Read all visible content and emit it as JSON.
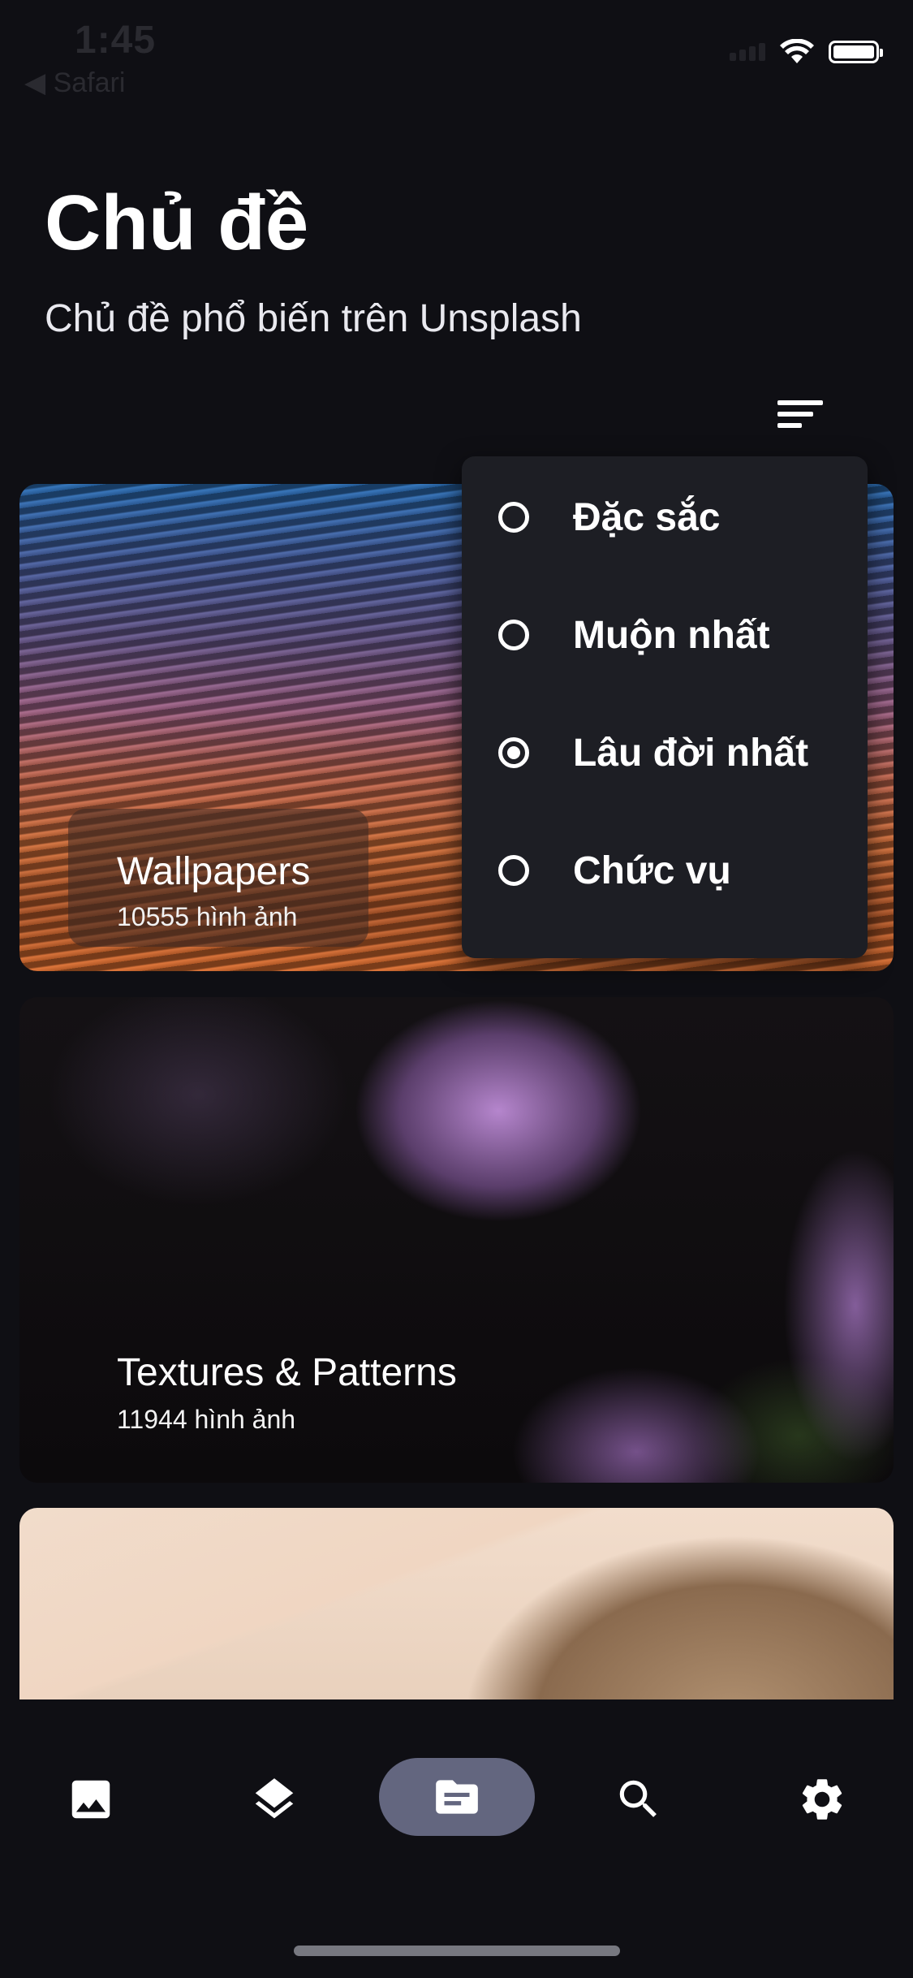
{
  "status_bar": {
    "time": "1:45",
    "back_label": "◀ Safari"
  },
  "header": {
    "title": "Chủ đề",
    "subtitle": "Chủ đề phổ biến trên Unsplash"
  },
  "topics": [
    {
      "title": "Wallpapers",
      "count": "10555 hình ảnh"
    },
    {
      "title": "Textures & Patterns",
      "count": "11944 hình ảnh"
    }
  ],
  "sort_menu": {
    "options": [
      {
        "label": "Đặc sắc",
        "selected": false
      },
      {
        "label": "Muộn nhất",
        "selected": false
      },
      {
        "label": "Lâu đời nhất",
        "selected": true
      },
      {
        "label": "Chức vụ",
        "selected": false
      }
    ]
  },
  "bottom_nav": {
    "items": [
      {
        "icon": "image-icon",
        "active": false
      },
      {
        "icon": "layers-icon",
        "active": false
      },
      {
        "icon": "topic-icon",
        "active": true
      },
      {
        "icon": "search-icon",
        "active": false
      },
      {
        "icon": "settings-icon",
        "active": false
      }
    ]
  },
  "colors": {
    "background": "#0f0f14",
    "menu_background": "#1d1e24",
    "active_nav_pill": "#63667f"
  }
}
